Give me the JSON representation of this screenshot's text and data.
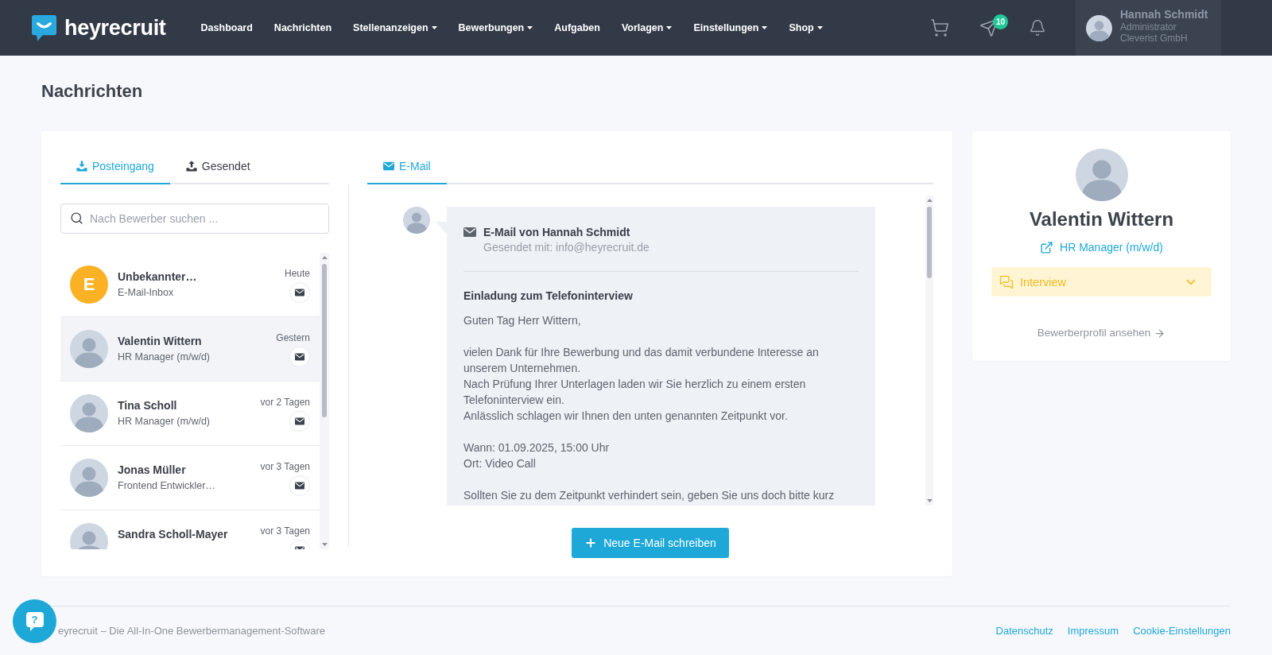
{
  "header": {
    "logo_text": "heyrecruit",
    "nav": [
      {
        "label": "Dashboard",
        "has_menu": false
      },
      {
        "label": "Nachrichten",
        "has_menu": false
      },
      {
        "label": "Stellenanzeigen",
        "has_menu": true
      },
      {
        "label": "Bewerbungen",
        "has_menu": true
      },
      {
        "label": "Aufgaben",
        "has_menu": false
      },
      {
        "label": "Vorlagen",
        "has_menu": true
      },
      {
        "label": "Einstellungen",
        "has_menu": true
      },
      {
        "label": "Shop",
        "has_menu": true
      }
    ],
    "message_badge": "10",
    "user": {
      "name": "Hannah Schmidt",
      "role": "Administrator",
      "company": "Cleverist GmbH"
    }
  },
  "page_title": "Nachrichten",
  "mailbox": {
    "tabs": [
      {
        "kind": "inbox",
        "label": "Posteingang",
        "selected": true
      },
      {
        "kind": "sent",
        "label": "Gesendet",
        "selected": false
      }
    ],
    "search": {
      "placeholder": "Nach Bewerber suchen ..."
    },
    "conversations": [
      {
        "kind": "initial",
        "initial": "E",
        "name": "Unbekannter…",
        "subtitle": "E-Mail-Inbox",
        "time": "Heute",
        "selected": false
      },
      {
        "kind": "photo",
        "name": "Valentin Wittern",
        "subtitle": "HR Manager (m/w/d)",
        "time": "Gestern",
        "selected": true
      },
      {
        "kind": "photo",
        "name": "Tina Scholl",
        "subtitle": "HR Manager (m/w/d)",
        "time": "vor 2 Tagen",
        "selected": false
      },
      {
        "kind": "photo",
        "name": "Jonas Müller",
        "subtitle": "Frontend Entwickler…",
        "time": "vor 3 Tagen",
        "selected": false
      },
      {
        "kind": "photo",
        "name": "Sandra Scholl-Mayer",
        "time": "vor 3 Tagen",
        "selected": false
      }
    ]
  },
  "message_view": {
    "tabs": [
      {
        "kind": "email",
        "label": "E-Mail",
        "selected": true
      }
    ],
    "message": {
      "title": "E-Mail von Hannah Schmidt",
      "sender_info": "Gesendet mit: info@heyrecruit.de",
      "subject": "Einladung zum Telefoninterview",
      "paragraphs": [
        [
          "Guten Tag Herr Wittern,"
        ],
        [
          "vielen Dank für Ihre Bewerbung und das damit verbundene Interesse an unserem Unternehmen.",
          "Nach Prüfung Ihrer Unterlagen laden wir Sie herzlich zu einem ersten Telefoninterview ein.",
          "Anlässlich schlagen wir Ihnen den unten genannten Zeitpunkt vor."
        ],
        [
          "Wann: 01.09.2025, 15:00 Uhr",
          "Ort: Video Call"
        ],
        [
          "Sollten Sie zu dem Zeitpunkt verhindert sein, geben Sie uns doch bitte kurz"
        ]
      ]
    },
    "compose_button": "Neue E-Mail schreiben"
  },
  "applicant": {
    "name": "Valentin Wittern",
    "job": "HR Manager (m/w/d)",
    "status": "Interview",
    "profile_link": "Bewerberprofil ansehen"
  },
  "footer": {
    "text": "eyrecruit – Die All-In-One Bewerbermanagement-Software",
    "links": [
      "Datenschutz",
      "Impressum",
      "Cookie-Einstellungen"
    ]
  },
  "help_button": "?"
}
